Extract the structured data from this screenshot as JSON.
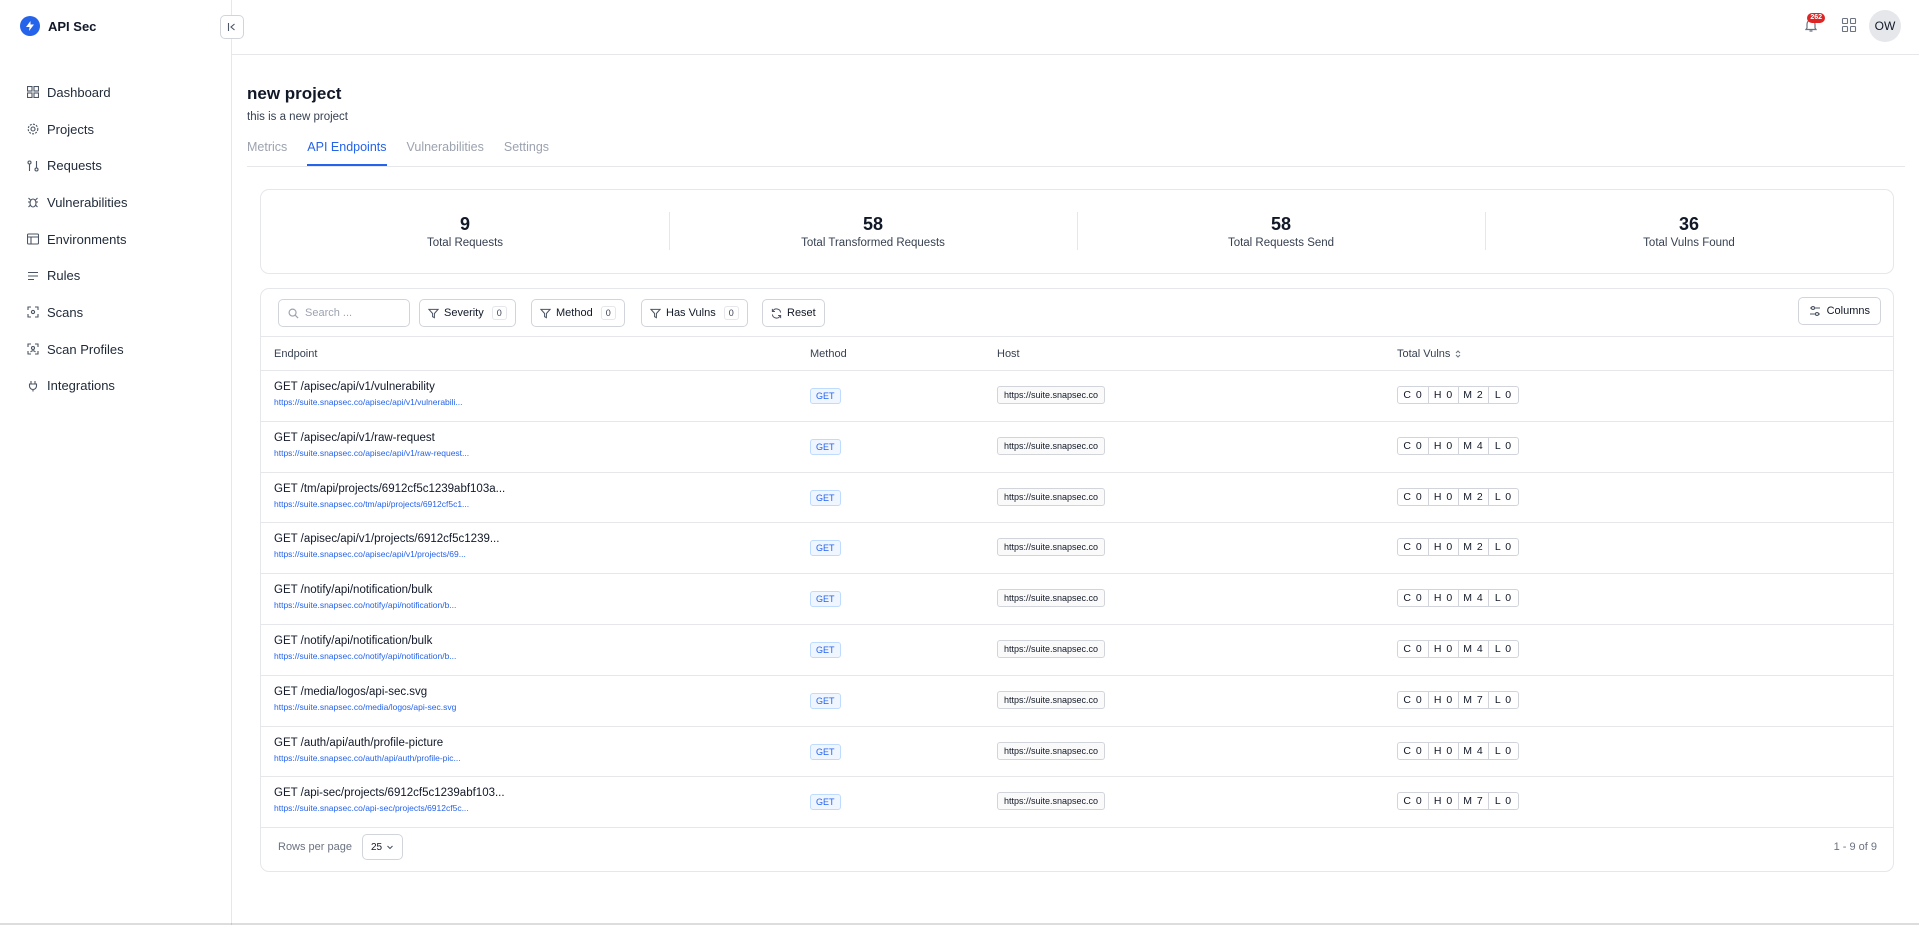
{
  "app": {
    "name": "API Sec",
    "accent": "#2563eb"
  },
  "sidebar": {
    "items": [
      {
        "label": "Dashboard",
        "icon": "dashboard-icon"
      },
      {
        "label": "Projects",
        "icon": "gear-icon"
      },
      {
        "label": "Requests",
        "icon": "requests-icon"
      },
      {
        "label": "Vulnerabilities",
        "icon": "bug-icon"
      },
      {
        "label": "Environments",
        "icon": "environment-icon"
      },
      {
        "label": "Rules",
        "icon": "list-icon"
      },
      {
        "label": "Scans",
        "icon": "scan-icon"
      },
      {
        "label": "Scan Profiles",
        "icon": "scan-profile-icon"
      },
      {
        "label": "Integrations",
        "icon": "plug-icon"
      }
    ]
  },
  "topbar": {
    "notification_count": "262",
    "user_initials": "OW"
  },
  "project": {
    "title": "new project",
    "description": "this is a new project"
  },
  "tabs": [
    {
      "label": "Metrics",
      "active": false
    },
    {
      "label": "API Endpoints",
      "active": true
    },
    {
      "label": "Vulnerabilities",
      "active": false
    },
    {
      "label": "Settings",
      "active": false
    }
  ],
  "stats": [
    {
      "value": "9",
      "label": "Total Requests"
    },
    {
      "value": "58",
      "label": "Total Transformed Requests"
    },
    {
      "value": "58",
      "label": "Total Requests Send"
    },
    {
      "value": "36",
      "label": "Total Vulns Found"
    }
  ],
  "toolbar": {
    "search_placeholder": "Search ...",
    "filters": [
      {
        "label": "Severity",
        "count": "0"
      },
      {
        "label": "Method",
        "count": "0"
      },
      {
        "label": "Has Vulns",
        "count": "0"
      }
    ],
    "reset_label": "Reset",
    "columns_label": "Columns"
  },
  "table": {
    "headers": {
      "endpoint": "Endpoint",
      "method": "Method",
      "host": "Host",
      "vulns": "Total Vulns"
    },
    "rows": [
      {
        "title": "GET /apisec/api/v1/vulnerability",
        "url": "https://suite.snapsec.co/apisec/api/v1/vulnerabili...",
        "method": "GET",
        "host": "https://suite.snapsec.co",
        "c": "C 0",
        "h": "H 0",
        "m": "M 2",
        "l": "L 0"
      },
      {
        "title": "GET /apisec/api/v1/raw-request",
        "url": "https://suite.snapsec.co/apisec/api/v1/raw-request...",
        "method": "GET",
        "host": "https://suite.snapsec.co",
        "c": "C 0",
        "h": "H 0",
        "m": "M 4",
        "l": "L 0"
      },
      {
        "title": "GET /tm/api/projects/6912cf5c1239abf103a...",
        "url": "https://suite.snapsec.co/tm/api/projects/6912cf5c1...",
        "method": "GET",
        "host": "https://suite.snapsec.co",
        "c": "C 0",
        "h": "H 0",
        "m": "M 2",
        "l": "L 0"
      },
      {
        "title": "GET /apisec/api/v1/projects/6912cf5c1239...",
        "url": "https://suite.snapsec.co/apisec/api/v1/projects/69...",
        "method": "GET",
        "host": "https://suite.snapsec.co",
        "c": "C 0",
        "h": "H 0",
        "m": "M 2",
        "l": "L 0"
      },
      {
        "title": "GET /notify/api/notification/bulk",
        "url": "https://suite.snapsec.co/notify/api/notification/b...",
        "method": "GET",
        "host": "https://suite.snapsec.co",
        "c": "C 0",
        "h": "H 0",
        "m": "M 4",
        "l": "L 0"
      },
      {
        "title": "GET /notify/api/notification/bulk",
        "url": "https://suite.snapsec.co/notify/api/notification/b...",
        "method": "GET",
        "host": "https://suite.snapsec.co",
        "c": "C 0",
        "h": "H 0",
        "m": "M 4",
        "l": "L 0"
      },
      {
        "title": "GET /media/logos/api-sec.svg",
        "url": "https://suite.snapsec.co/media/logos/api-sec.svg",
        "method": "GET",
        "host": "https://suite.snapsec.co",
        "c": "C 0",
        "h": "H 0",
        "m": "M 7",
        "l": "L 0"
      },
      {
        "title": "GET /auth/api/auth/profile-picture",
        "url": "https://suite.snapsec.co/auth/api/auth/profile-pic...",
        "method": "GET",
        "host": "https://suite.snapsec.co",
        "c": "C 0",
        "h": "H 0",
        "m": "M 4",
        "l": "L 0"
      },
      {
        "title": "GET /api-sec/projects/6912cf5c1239abf103...",
        "url": "https://suite.snapsec.co/api-sec/projects/6912cf5c...",
        "method": "GET",
        "host": "https://suite.snapsec.co",
        "c": "C 0",
        "h": "H 0",
        "m": "M 7",
        "l": "L 0"
      }
    ]
  },
  "footer": {
    "rows_per_page_label": "Rows per page",
    "rows_per_page_value": "25",
    "pagination": "1 - 9 of 9"
  }
}
